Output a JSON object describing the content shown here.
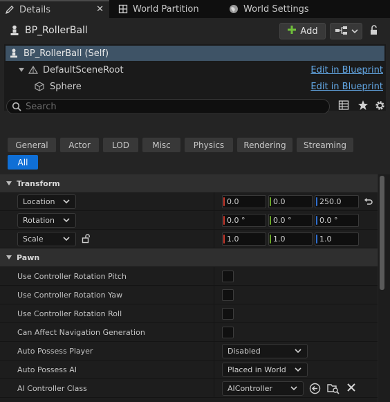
{
  "tabs": [
    {
      "label": "Details",
      "icon": "pencil-icon",
      "active": true
    },
    {
      "label": "World Partition",
      "icon": "grid-icon",
      "active": false
    },
    {
      "label": "World Settings",
      "icon": "globe-icon",
      "active": false
    }
  ],
  "header": {
    "actor_name": "BP_RollerBall",
    "add_label": "Add",
    "add_icon": "plus-icon",
    "blueprint_icon": "blueprint-hierarchy-icon"
  },
  "tree": {
    "self_label": "BP_RollerBall (Self)",
    "items": [
      {
        "label": "DefaultSceneRoot",
        "link": "Edit in Blueprint"
      },
      {
        "label": "Sphere",
        "link": "Edit in Blueprint"
      }
    ]
  },
  "search": {
    "placeholder": "Search"
  },
  "filters": [
    "General",
    "Actor",
    "LOD",
    "Misc",
    "Physics",
    "Rendering",
    "Streaming",
    "All"
  ],
  "active_filter": "All",
  "transform": {
    "title": "Transform",
    "location": {
      "label": "Location",
      "x": "0.0",
      "y": "0.0",
      "z": "250.0"
    },
    "rotation": {
      "label": "Rotation",
      "x": "0.0 °",
      "y": "0.0 °",
      "z": "0.0 °"
    },
    "scale": {
      "label": "Scale",
      "x": "1.0",
      "y": "1.0",
      "z": "1.0"
    }
  },
  "pawn": {
    "title": "Pawn",
    "use_pitch": "Use Controller Rotation Pitch",
    "use_yaw": "Use Controller Rotation Yaw",
    "use_roll": "Use Controller Rotation Roll",
    "can_affect_nav": "Can Affect Navigation Generation",
    "auto_possess_player": {
      "label": "Auto Possess Player",
      "value": "Disabled"
    },
    "auto_possess_ai": {
      "label": "Auto Possess AI",
      "value": "Placed in World"
    },
    "ai_controller_class": {
      "label": "AI Controller Class",
      "value": "AIController"
    }
  },
  "colors": {
    "accent": "#0f6fd6",
    "selection": "#3e5366",
    "link": "#63a8e6",
    "axis_x": "#c83a2e",
    "axis_y": "#6aa62a",
    "axis_z": "#2f6fd0",
    "add_plus": "#6fbf3a"
  }
}
